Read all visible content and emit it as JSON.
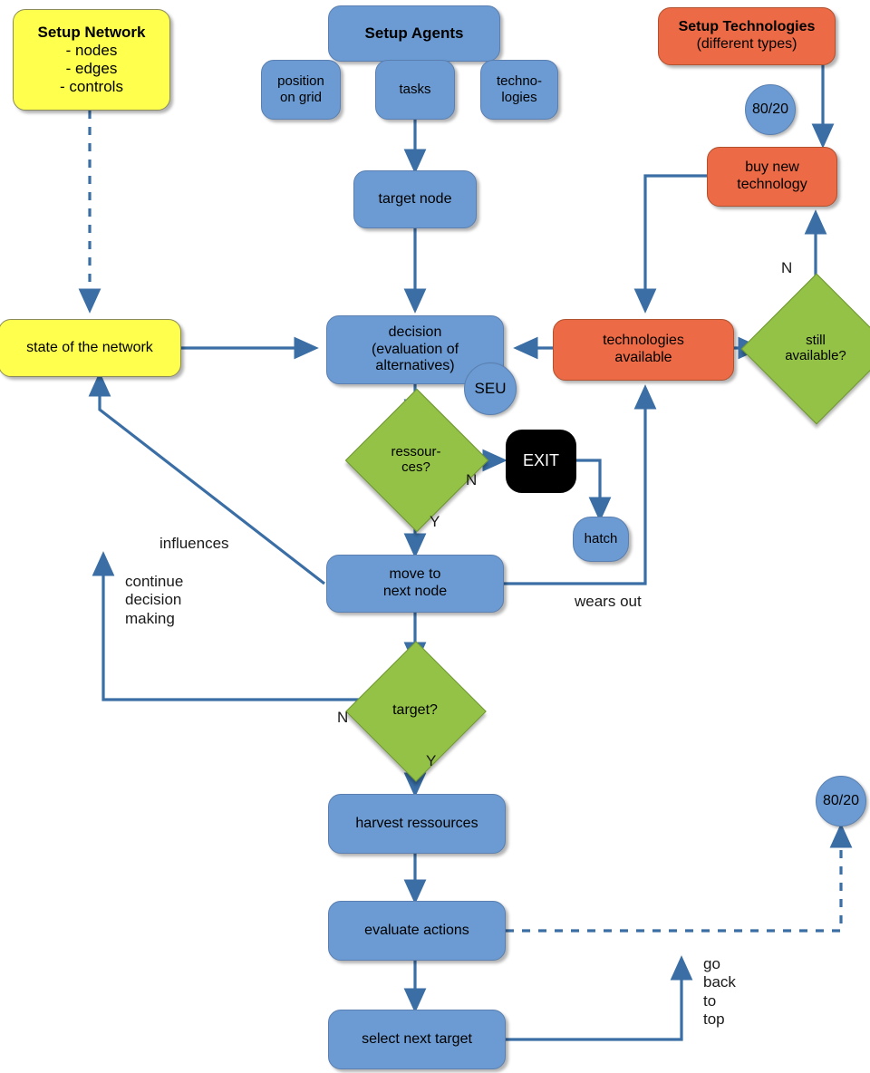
{
  "diagram": {
    "title": "Agent-based simulation flowchart",
    "colors": {
      "blue_fill": "#6b9bd2",
      "yellow_fill": "#ffff4d",
      "orange_fill": "#ec6a45",
      "green_fill": "#93c246",
      "black_fill": "#000000",
      "edge_stroke": "#3a6ea5"
    }
  },
  "nodes": {
    "setup_network": {
      "title": "Setup Network",
      "body": "- nodes\n- edges\n- controls"
    },
    "setup_agents": {
      "label": "Setup Agents"
    },
    "position_on_grid": {
      "label": "position\non grid"
    },
    "tasks": {
      "label": "tasks"
    },
    "technologies_attr": {
      "label": "techno-\nlogies"
    },
    "setup_technologies": {
      "title": "Setup Technologies",
      "subtitle": "(different types)"
    },
    "pareto_top": {
      "label": "80/20"
    },
    "buy_new_technology": {
      "label": "buy new\ntechnology"
    },
    "target_node": {
      "label": "target node"
    },
    "state_of_network": {
      "label": "state of the network"
    },
    "decision": {
      "label": "decision\n(evaluation of\nalternatives)"
    },
    "seu": {
      "label": "SEU"
    },
    "technologies_available": {
      "label": "technologies\navailable"
    },
    "still_available": {
      "label": "still\navailable?"
    },
    "ressources": {
      "label": "ressour-\nces?"
    },
    "exit": {
      "label": "EXIT"
    },
    "hatch": {
      "label": "hatch"
    },
    "move_to_next_node": {
      "label": "move to\nnext node"
    },
    "target": {
      "label": "target?"
    },
    "harvest_ressources": {
      "label": "harvest ressources"
    },
    "evaluate_actions": {
      "label": "evaluate actions"
    },
    "select_next_target": {
      "label": "select next target"
    },
    "pareto_bottom": {
      "label": "80/20"
    }
  },
  "edge_labels": {
    "still_available_no": "N",
    "ressources_no": "N",
    "ressources_yes": "Y",
    "target_no": "N",
    "target_yes": "Y",
    "influences": "influences",
    "continue_decision_making": "continue\ndecision\nmaking",
    "wears_out": "wears out",
    "go_back_to_top": "go\nback\nto\ntop"
  }
}
